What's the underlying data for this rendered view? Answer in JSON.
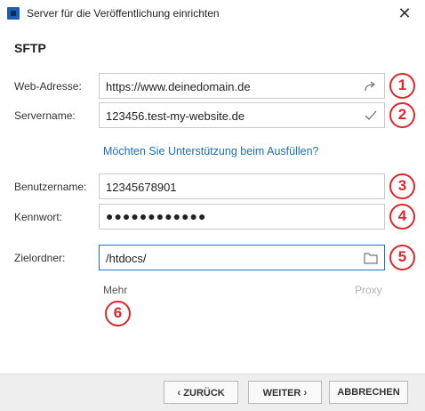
{
  "window": {
    "title": "Server für die Veröffentlichung einrichten",
    "close_glyph": "✕"
  },
  "section_title": "SFTP",
  "fields": {
    "web_address": {
      "label": "Web-Adresse:",
      "value": "https://www.deinedomain.de",
      "icon": "share-arrow-icon",
      "badge": "1"
    },
    "servername": {
      "label": "Servername:",
      "value": "123456.test-my-website.de",
      "icon": "checkmark-icon",
      "badge": "2"
    },
    "username": {
      "label": "Benutzername:",
      "value": "12345678901",
      "badge": "3"
    },
    "password": {
      "label": "Kennwort:",
      "value": "●●●●●●●●●●●●",
      "badge": "4"
    },
    "target_folder": {
      "label": "Zielordner:",
      "value": "/htdocs/",
      "icon": "folder-icon",
      "badge": "5"
    }
  },
  "help_link": "Möchten Sie Unterstützung beim Ausfüllen?",
  "more": {
    "label": "Mehr",
    "badge": "6"
  },
  "proxy_label": "Proxy",
  "footer": {
    "back_chevron": "‹",
    "back_label": "ZURÜCK",
    "next_label": "WEITER",
    "next_chevron": "›",
    "cancel_label": "ABBRECHEN"
  },
  "colors": {
    "accent": "#1a6fc0",
    "badge_red": "#e0262b",
    "focus_border": "#1a73c8"
  }
}
